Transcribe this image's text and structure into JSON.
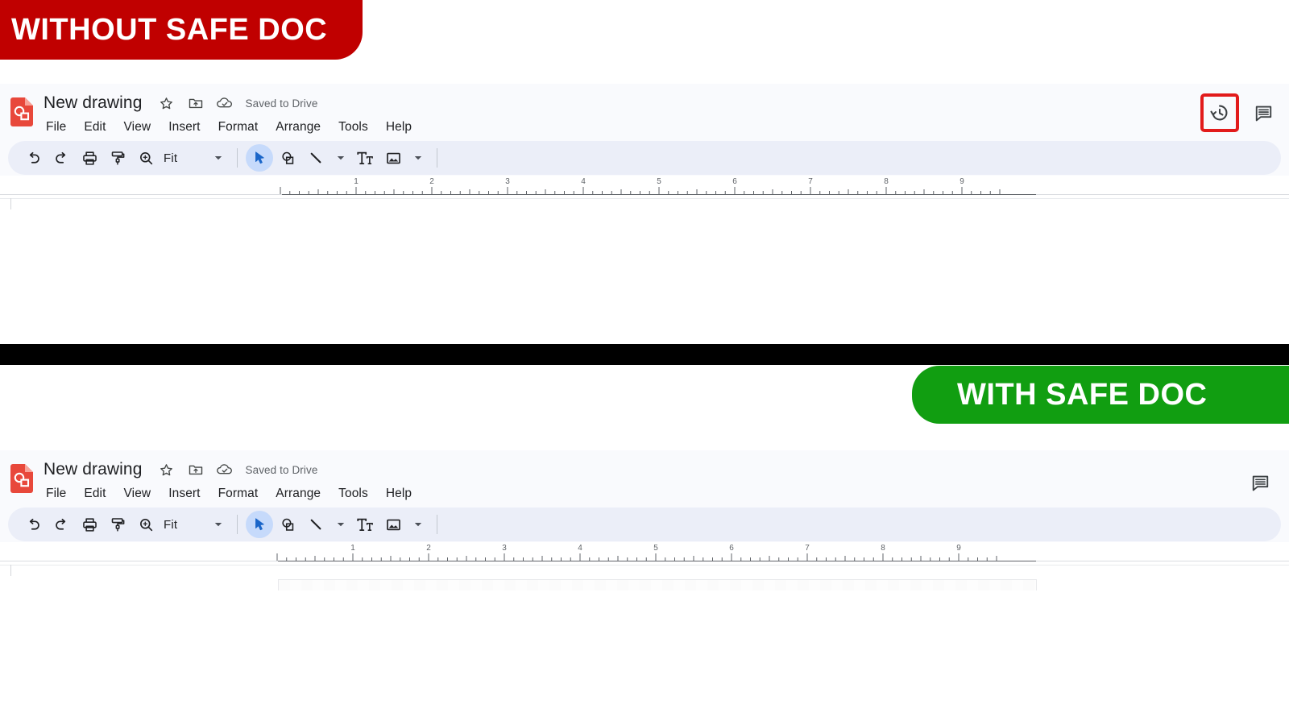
{
  "banners": {
    "without": {
      "label": "WITHOUT SAFE DOC",
      "color": "#C00000"
    },
    "with": {
      "label": "WITH SAFE DOC",
      "color": "#119E11"
    }
  },
  "divider": {
    "color": "#000000"
  },
  "app_top": {
    "logo": "google-drawings-logo",
    "title": "New drawing",
    "star_icon": "star-icon",
    "move_icon": "move-to-folder-icon",
    "cloud_icon": "cloud-icon",
    "save_status": "Saved to Drive",
    "menus": [
      "File",
      "Edit",
      "View",
      "Insert",
      "Format",
      "Arrange",
      "Tools",
      "Help"
    ],
    "right_actions": [
      {
        "name": "version-history-icon",
        "highlighted": true,
        "highlight_color": "#E21B1B"
      },
      {
        "name": "comment-icon",
        "highlighted": false
      }
    ],
    "toolbar": {
      "undo": "undo-icon",
      "redo": "redo-icon",
      "print": "print-icon",
      "paint_format": "paint-format-icon",
      "zoom": "zoom-icon",
      "zoom_value": "Fit",
      "zoom_caret": "chevron-down-icon",
      "select": "select-cursor-icon",
      "shape": "shape-icon",
      "line": "line-icon",
      "line_caret": "chevron-down-icon",
      "text_box": "text-box-icon",
      "image": "image-icon",
      "image_caret": "chevron-down-icon",
      "active_tool": "select"
    },
    "ruler": {
      "labels": [
        1,
        2,
        3,
        4,
        5,
        6,
        7,
        8,
        9
      ],
      "unit": "inches"
    }
  },
  "app_bottom": {
    "logo": "google-drawings-logo",
    "title": "New drawing",
    "star_icon": "star-icon",
    "move_icon": "move-to-folder-icon",
    "cloud_icon": "cloud-icon",
    "save_status": "Saved to Drive",
    "menus": [
      "File",
      "Edit",
      "View",
      "Insert",
      "Format",
      "Arrange",
      "Tools",
      "Help"
    ],
    "right_actions": [
      {
        "name": "comment-icon",
        "highlighted": false
      }
    ],
    "toolbar": {
      "undo": "undo-icon",
      "redo": "redo-icon",
      "print": "print-icon",
      "paint_format": "paint-format-icon",
      "zoom": "zoom-icon",
      "zoom_value": "Fit",
      "zoom_caret": "chevron-down-icon",
      "select": "select-cursor-icon",
      "shape": "shape-icon",
      "line": "line-icon",
      "line_caret": "chevron-down-icon",
      "text_box": "text-box-icon",
      "image": "image-icon",
      "image_caret": "chevron-down-icon",
      "active_tool": "select"
    },
    "ruler": {
      "labels": [
        1,
        2,
        3,
        4,
        5,
        6,
        7,
        8,
        9
      ],
      "unit": "inches"
    }
  }
}
